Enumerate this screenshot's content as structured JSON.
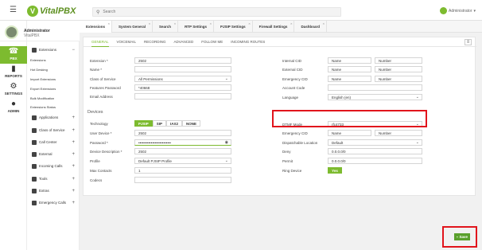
{
  "header": {
    "logo_text": "VitalPBX",
    "search_placeholder": "Search",
    "user_label": "Administrator"
  },
  "profile": {
    "name": "Administrator",
    "subtitle": "VitalPBX"
  },
  "rail": {
    "items": [
      {
        "label": "PBX"
      },
      {
        "label": "REPORTS"
      },
      {
        "label": "SETTINGS"
      },
      {
        "label": "ADMIN"
      }
    ]
  },
  "submenu": {
    "extensions": "Extensions",
    "sub_items": [
      "Extensions",
      "Hot Desking",
      "Import Extensions",
      "Export Extensions",
      "Bulk Modification",
      "Extensions Status"
    ],
    "groups": [
      "Applications",
      "Class of Service",
      "Call Center",
      "External",
      "Incoming Calls",
      "Tools",
      "Extras",
      "Emergency Calls"
    ]
  },
  "tabs": [
    "Extensions",
    "System General",
    "Search",
    "RTP Settings",
    "PJSIP Settings",
    "Firewall Settings",
    "Dashboard"
  ],
  "subtabs": [
    "GENERAL",
    "VOICEMAIL",
    "RECORDING",
    "ADVANCED",
    "FOLLOW ME",
    "INCOMING ROUTES"
  ],
  "form": {
    "extension_label": "Extension *",
    "extension_value": "2502",
    "name_label": "Name *",
    "name_value": "",
    "cos_label": "Class of Service",
    "cos_value": "All Permissions",
    "features_pw_label": "Features Password",
    "features_pw_value": "*40668",
    "email_label": "Email Address",
    "email_value": "",
    "internal_cid_label": "Internal CID",
    "internal_cid_name": "Name",
    "internal_cid_number": "Number",
    "external_cid_label": "External CID",
    "external_cid_name": "Name",
    "external_cid_number": "Number",
    "emergency_cid_label": "Emergency CID",
    "emergency_cid_name": "Name",
    "emergency_cid_number": "Number",
    "account_code_label": "Account Code",
    "language_label": "Language",
    "language_value": "English (en)"
  },
  "devices": {
    "section_title": "Devices",
    "technology_label": "Technology",
    "technologies": [
      "PJSIP",
      "SIP",
      "IAX2",
      "NONE"
    ],
    "user_device_label": "User Device *",
    "user_device_value": "2502",
    "password_label": "Password *",
    "password_value": "••••••••••••••••••••••••••",
    "device_desc_label": "Device Description *",
    "device_desc_value": "2502",
    "profile_label": "Profile",
    "profile_value": "Default PJSIP Profile",
    "max_contacts_label": "Max Contacts",
    "max_contacts_value": "1",
    "codecs_label": "Codecs",
    "dtmf_label": "DTMF Mode",
    "dtmf_value": "rfc4733",
    "emergency_cid_label": "Emergency CID",
    "emergency_cid_name": "Name",
    "emergency_cid_number": "Number",
    "dispatchable_label": "Dispatchable Location",
    "dispatchable_value": "Default",
    "deny_label": "Deny",
    "deny_value": "0.0.0.0/0",
    "permit_label": "Permit",
    "permit_value": "0.0.0.0/0",
    "ring_device_label": "Ring Device",
    "ring_device_value": "Yes"
  },
  "save_label": "Save",
  "colors": {
    "accent": "#7dbb2f",
    "highlight": "#e1141c"
  }
}
